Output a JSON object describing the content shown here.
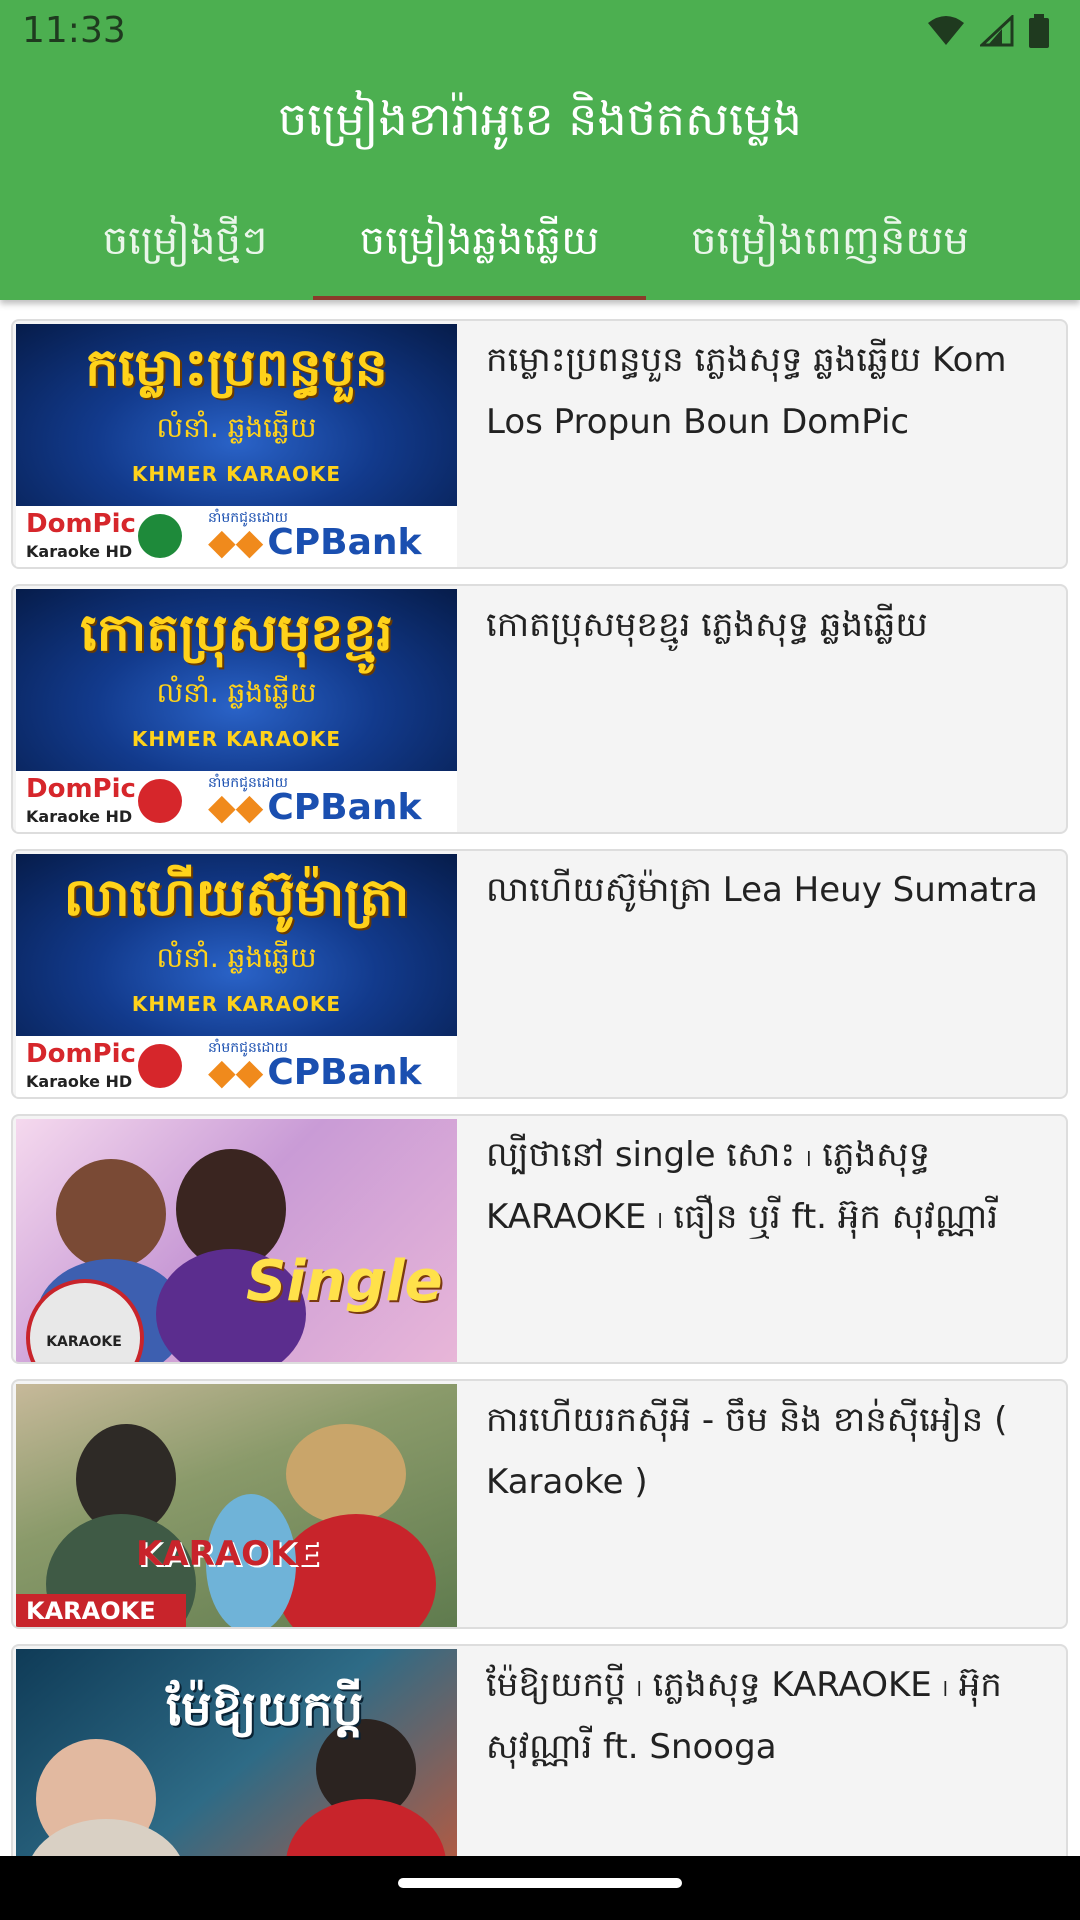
{
  "status_bar": {
    "time": "11:33",
    "icons": [
      "wifi-icon",
      "signal-icon",
      "battery-icon"
    ]
  },
  "app": {
    "title": "ចម្រៀងខារ៉ាអូខេ និងថតសម្លេង"
  },
  "tabs": [
    {
      "label": "ចម្រៀងថ្មីៗ",
      "active": false
    },
    {
      "label": "ចម្រៀងឆ្លងឆ្លើយ",
      "active": true
    },
    {
      "label": "ចម្រៀងពេញនិយម",
      "active": false
    }
  ],
  "colors": {
    "app_bar": "#4CAF50",
    "tab_indicator": "#8a3b2a",
    "card_bg": "#f4f4f4"
  },
  "songs": [
    {
      "caption": "កម្លោះប្រពន្ធបួន ភ្លេងសុទ្ធ ឆ្លងឆ្លើយ Kom Los Propun Boun DomPic",
      "thumb": {
        "title": "កម្លោះប្រពន្ធបួន",
        "sub": "លំនាំ. ឆ្លងឆ្លើយ",
        "karaoke": "KHMER KARAOKE",
        "brand": "DomPic",
        "brand_sub": "Karaoke HD",
        "sponsor": "នាំមកជូនដោយ",
        "bank": "CPBank"
      }
    },
    {
      "caption": "កោតប្រុសមុខខ្មូរ ភ្លេងសុទ្ធ ឆ្លងឆ្លើយ",
      "thumb": {
        "title": "កោតប្រុសមុខខ្មូរ",
        "sub": "លំនាំ. ឆ្លងឆ្លើយ",
        "karaoke": "KHMER KARAOKE",
        "brand": "DomPic",
        "brand_sub": "Karaoke HD",
        "sponsor": "នាំមកជូនដោយ",
        "bank": "CPBank"
      }
    },
    {
      "caption": "លាហើយស៊ូម៉ាត្រា Lea Heuy Sumatra",
      "thumb": {
        "title": "លាហើយស៊ូម៉ាត្រា",
        "sub": "លំនាំ. ឆ្លងឆ្លើយ",
        "karaoke": "KHMER KARAOKE",
        "brand": "DomPic",
        "brand_sub": "Karaoke HD",
        "sponsor": "នាំមកជូនដោយ",
        "bank": "CPBank"
      }
    },
    {
      "caption": "ល្បីថានៅ single សោះ ၊ ភ្លេងសុទ្ធ KARAOKE ၊ ធឿន ឬរី ft. អ៊ុក សុវណ្ណារី",
      "thumb": {
        "title": "Single",
        "badge": "KARAOKE"
      }
    },
    {
      "caption": "ការហើយរកស៊ីអី - ចឹម និង ខាន់ស៊ីអៀន ( Karaoke )",
      "thumb": {
        "title": "KARAOKE",
        "strip": "KARAOKE"
      }
    },
    {
      "caption": "ម៉ែឱ្យយកប្ដី ၊ ភ្លេងសុទ្ធ KARAOKE ၊ អ៊ុក សុវណ្ណារី ft. Snooga",
      "thumb": {
        "title": "ម៉ែឱ្យយកប្ដី"
      }
    }
  ]
}
